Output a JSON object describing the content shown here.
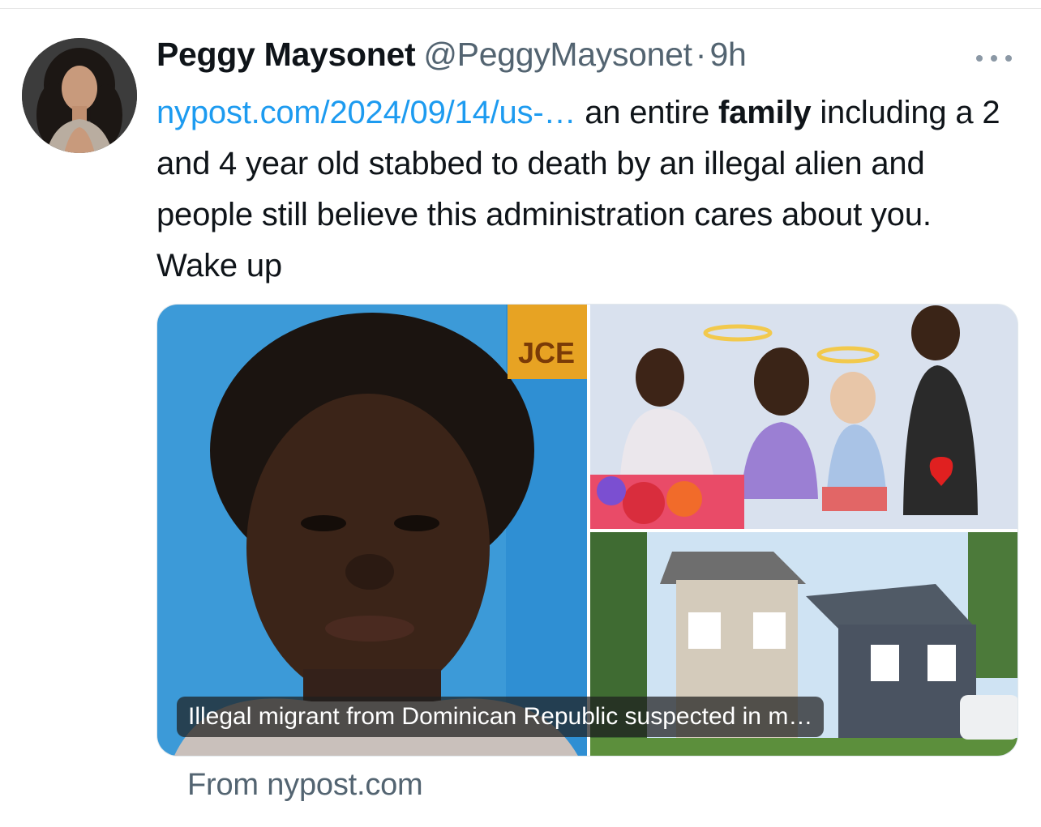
{
  "tweet": {
    "author": {
      "display_name": "Peggy Maysonet",
      "handle": "@PeggyMaysonet",
      "separator": "·",
      "timestamp": "9h"
    },
    "text": {
      "link": "nypost.com/2024/09/14/us-…",
      "before_bold": " an entire ",
      "bold": "family",
      "rest": " including a 2 and 4 year old stabbed to death by an illegal alien and people still believe this administration cares about you. Wake up"
    },
    "card": {
      "caption": "Illegal migrant from Dominican Republic suspected in m…",
      "source": "From nypost.com",
      "id_badge_text": "JCE"
    }
  },
  "icons": {
    "more": "more-horizontal-icon"
  },
  "colors": {
    "link": "#1d9bf0",
    "secondary_text": "#536471",
    "primary_text": "#0f1419"
  }
}
